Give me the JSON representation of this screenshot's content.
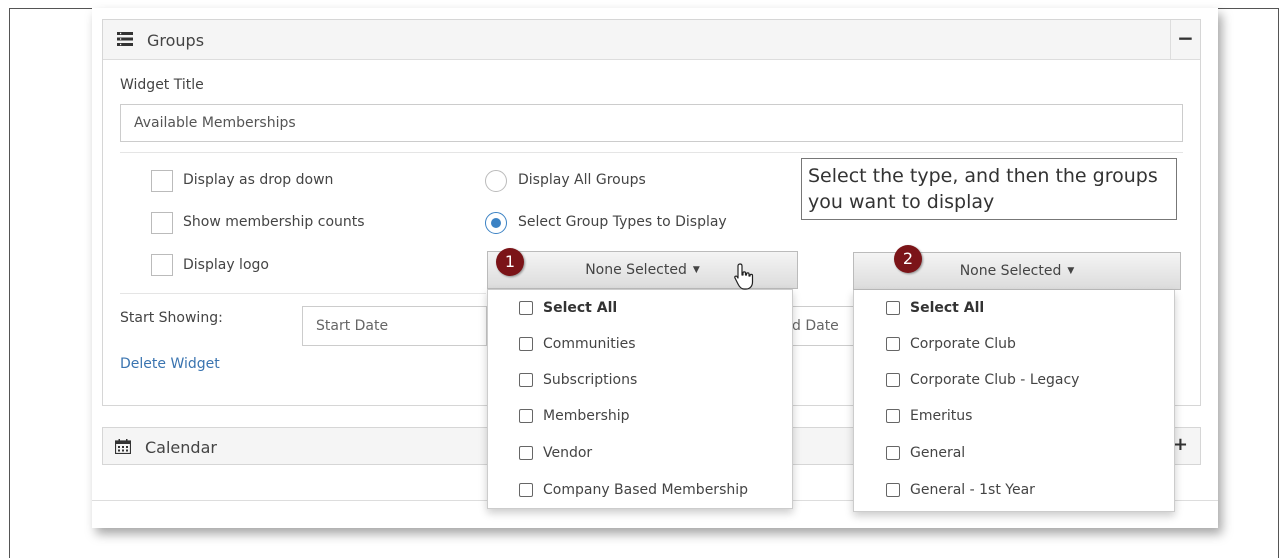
{
  "groups_panel": {
    "title": "Groups",
    "collapse_glyph": "−",
    "widget_title_label": "Widget Title",
    "widget_title_value": "Available Memberships",
    "checkboxes": [
      {
        "label": "Display as drop down",
        "checked": false
      },
      {
        "label": "Show membership counts",
        "checked": false
      },
      {
        "label": "Display logo",
        "checked": false
      }
    ],
    "radios": [
      {
        "label": "Display All Groups",
        "checked": false
      },
      {
        "label": "Select Group Types to Display",
        "checked": true
      }
    ],
    "start_showing_label": "Start Showing:",
    "start_date_placeholder": "Start Date",
    "end_date_placeholder_partial": "d Date",
    "delete_link": "Delete Widget"
  },
  "callout": {
    "text": "Select the type, and then the groups you want to display"
  },
  "dropdown1": {
    "badge": "1",
    "label": "None Selected",
    "items": [
      {
        "label": "Select All",
        "bold": true
      },
      {
        "label": "Communities",
        "bold": false
      },
      {
        "label": "Subscriptions",
        "bold": false
      },
      {
        "label": "Membership",
        "bold": false
      },
      {
        "label": "Vendor",
        "bold": false
      },
      {
        "label": "Company Based Membership",
        "bold": false
      }
    ]
  },
  "dropdown2": {
    "badge": "2",
    "label": "None Selected",
    "items": [
      {
        "label": "Select All",
        "bold": true
      },
      {
        "label": "Corporate Club",
        "bold": false
      },
      {
        "label": "Corporate Club - Legacy",
        "bold": false
      },
      {
        "label": "Emeritus",
        "bold": false
      },
      {
        "label": "General",
        "bold": false
      },
      {
        "label": "General - 1st Year",
        "bold": false
      }
    ]
  },
  "calendar_panel": {
    "title": "Calendar",
    "expand_glyph": "+"
  },
  "colors": {
    "badge": "#7b1418",
    "link": "#3a74b0",
    "radio_selected": "#3b82c4"
  },
  "icons": {
    "groups_panel": "list-icon",
    "calendar_panel": "calendar-icon",
    "pointer": "hand-pointer-icon"
  }
}
